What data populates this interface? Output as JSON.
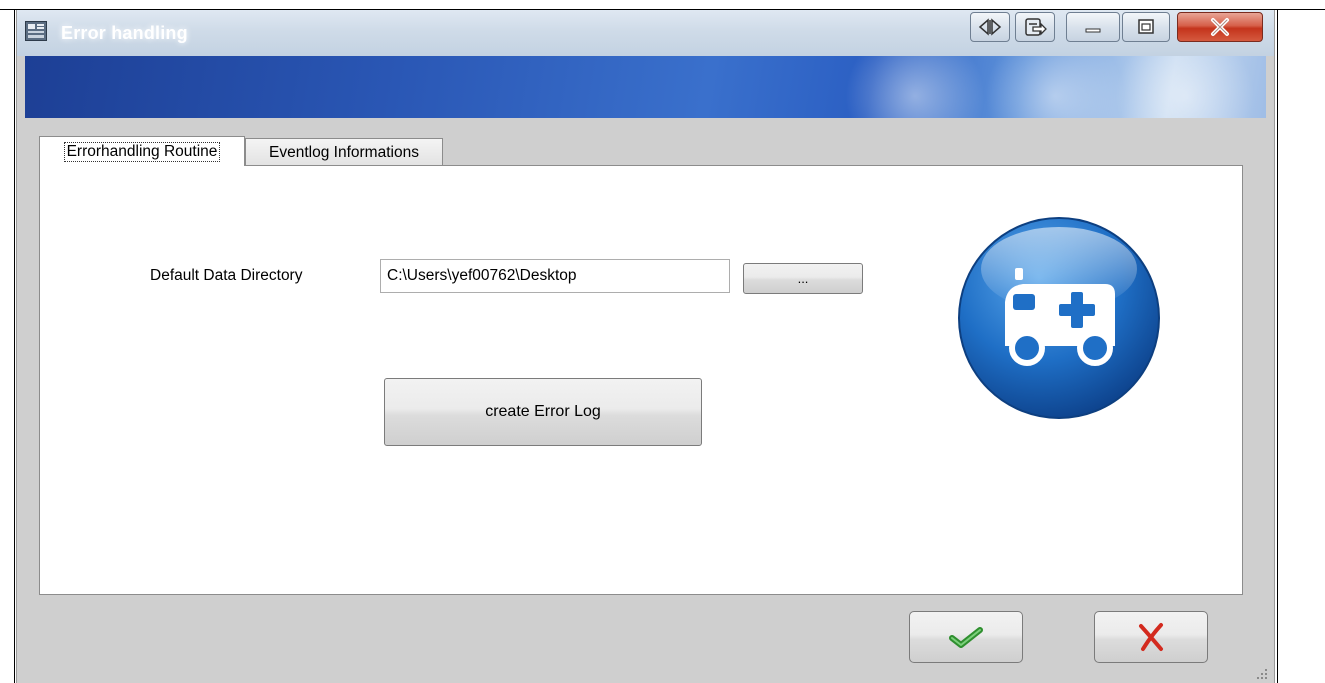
{
  "window": {
    "title": "Error handling",
    "icon": "app-window-icon",
    "caption_buttons": [
      "scroll-arrows-icon",
      "navigate-icon",
      "minimize-icon",
      "maximize-icon",
      "close-icon"
    ]
  },
  "tabs": [
    {
      "label": "Errorhandling Routine",
      "active": true
    },
    {
      "label": "Eventlog Informations",
      "active": false
    }
  ],
  "form": {
    "directory_label": "Default Data Directory",
    "directory_value": "C:\\Users\\yef00762\\Desktop",
    "browse_label": "...",
    "create_button_label": "create Error Log",
    "illustration": "ambulance-icon"
  },
  "footer": {
    "ok_icon": "checkmark-icon",
    "cancel_icon": "x-icon"
  },
  "colors": {
    "banner": "#2a57b5",
    "ambulance_circle": "#1f6fc6",
    "check_green": "#3aa43a",
    "cancel_red": "#d32a1e"
  }
}
